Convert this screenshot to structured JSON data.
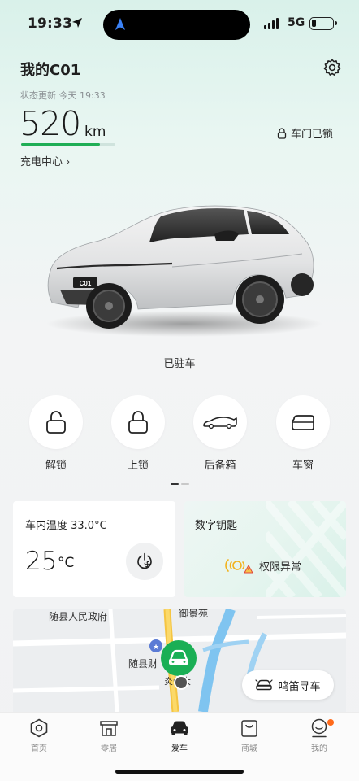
{
  "status_bar": {
    "time": "19:33",
    "network": "5G",
    "location_icon": "location-arrow-icon",
    "navigation_icon": "navigation-arrow-icon"
  },
  "header": {
    "car_name": "我的C01",
    "status_update": "状态更新  今天 19:33",
    "range_value": "520",
    "range_unit": "km",
    "charge_center": "充电中心  ›",
    "door_status": "车门已锁",
    "settings_icon": "gear-icon"
  },
  "car": {
    "plate_text": "C01",
    "parked_status": "已驻车"
  },
  "actions": [
    {
      "label": "解锁",
      "icon": "unlock-icon"
    },
    {
      "label": "上锁",
      "icon": "lock-icon"
    },
    {
      "label": "后备箱",
      "icon": "trunk-icon"
    },
    {
      "label": "车窗",
      "icon": "window-icon"
    }
  ],
  "climate": {
    "title": "车内温度  33.0°C",
    "set_temp": "25",
    "unit": "°C"
  },
  "digital_key": {
    "title": "数字钥匙",
    "status": "权限异常"
  },
  "map": {
    "labels": [
      "随县人民政府",
      "御景苑",
      "随县财",
      "炎帝大"
    ],
    "honk_button": "鸣笛寻车"
  },
  "tabs": [
    {
      "label": "首页",
      "icon": "home-hexagon-icon"
    },
    {
      "label": "零居",
      "icon": "store-icon"
    },
    {
      "label": "爱车",
      "icon": "car-icon",
      "active": true
    },
    {
      "label": "商城",
      "icon": "shopping-bag-icon"
    },
    {
      "label": "我的",
      "icon": "profile-icon",
      "badge": true
    }
  ],
  "colors": {
    "accent_green": "#1fae55",
    "badge_orange": "#ff6a1a",
    "warning_yellow": "#f2b21c"
  }
}
